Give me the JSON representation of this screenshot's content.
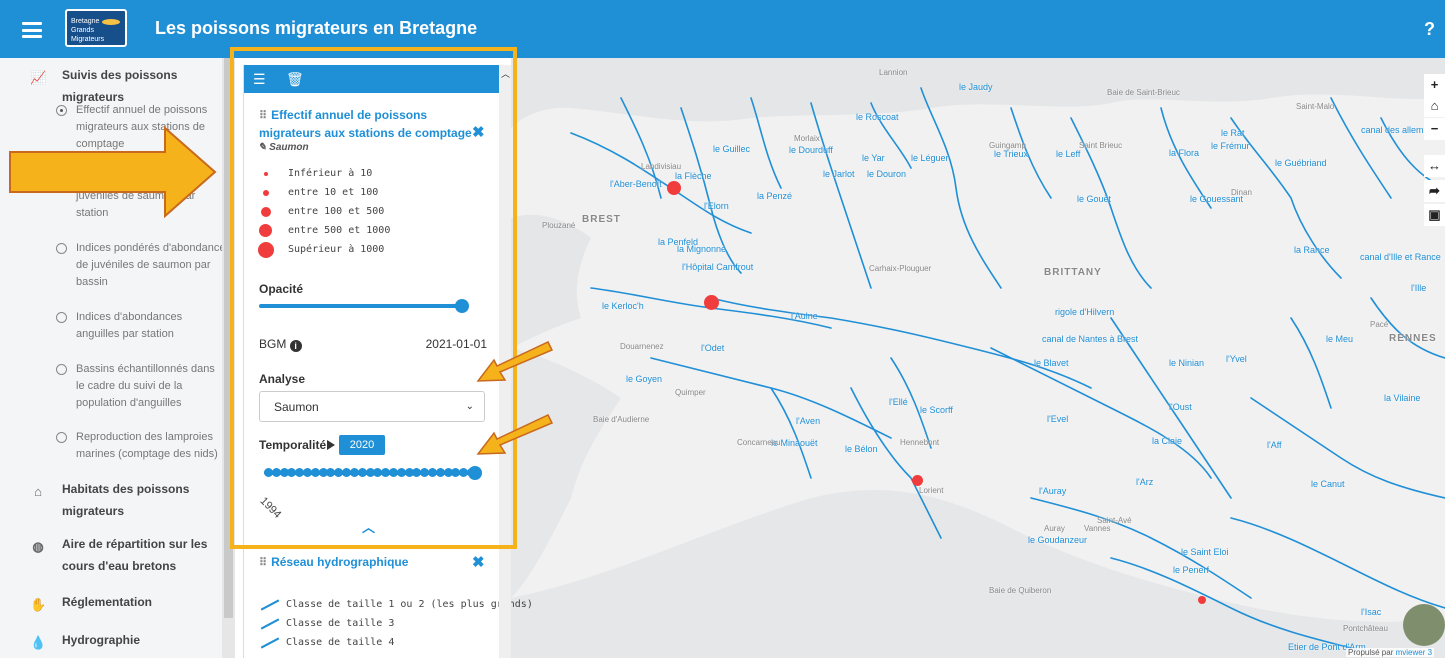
{
  "header": {
    "title": "Les poissons migrateurs en Bretagne",
    "logo_text_1": "Bretagne",
    "logo_text_2": "Grands Migrateurs",
    "help": "?",
    "bg_color": "#1f8fd6"
  },
  "sidebar": {
    "categories": [
      {
        "label": "Suivis des poissons migrateurs",
        "icon": "chart-line-icon"
      },
      {
        "label": "Habitats des poissons migrateurs",
        "icon": "house-icon"
      },
      {
        "label": "Aire de répartition sur les cours d'eau bretons",
        "icon": "globe-icon"
      },
      {
        "label": "Réglementation",
        "icon": "hand-icon"
      },
      {
        "label": "Hydrographie",
        "icon": "drop-icon"
      }
    ],
    "items": [
      {
        "label": "Effectif annuel de poissons migrateurs aux stations de comptage",
        "selected": true
      },
      {
        "label": "Indices d'abondance de juvéniles de saumon par station",
        "selected": false
      },
      {
        "label": "Indices pondérés d'abondance de juvéniles de saumon par bassin",
        "selected": false
      },
      {
        "label": "Indices d'abondances anguilles par station",
        "selected": false
      },
      {
        "label": "Bassins échantillonnés dans le cadre du suivi de la population d'anguilles",
        "selected": false
      },
      {
        "label": "Reproduction des lamproies marines (comptage des nids)",
        "selected": false
      }
    ]
  },
  "panel": {
    "layer_title": "Effectif annuel de poissons migrateurs aux stations de comptage",
    "sublabel": "Saumon",
    "legend": [
      "Inférieur à 10",
      "entre 10 et 100",
      "entre 100 et 500",
      "entre 500 et 1000",
      "Supérieur à 1000"
    ],
    "opacity_label": "Opacité",
    "opacity_value": 1.0,
    "source_label": "BGM",
    "source_date": "2021-01-01",
    "analyse_label": "Analyse",
    "analyse_value": "Saumon",
    "temporalite_label": "Temporalité",
    "temporalite_year": "2020",
    "year_start": "1994",
    "layer2_title": "Réseau hydrographique",
    "layer2_legend": [
      "Classe de taille 1 ou 2 (les plus grands)",
      "Classe de taille 3",
      "Classe de taille 4"
    ]
  },
  "map": {
    "labels": [
      {
        "text": "le Jaudy"
      },
      {
        "text": "le Roscoat"
      },
      {
        "text": "le Guillec"
      },
      {
        "text": "le Dourduff"
      },
      {
        "text": "le Yar"
      },
      {
        "text": "le Léguer"
      },
      {
        "text": "le Trieux"
      },
      {
        "text": "le Leff"
      },
      {
        "text": "le Jarlot"
      },
      {
        "text": "le Douron"
      },
      {
        "text": "la Flèche"
      },
      {
        "text": "l'Aber-Benoît"
      },
      {
        "text": "la Penzé"
      },
      {
        "text": "l'Elorn"
      },
      {
        "text": "la Penfeld"
      },
      {
        "text": "la Mignonne"
      },
      {
        "text": "l'Hôpital Camfrout"
      },
      {
        "text": "le Kerloc'h"
      },
      {
        "text": "le Gouët"
      },
      {
        "text": "le Gouessant"
      },
      {
        "text": "la Flora"
      },
      {
        "text": "le Frémur"
      },
      {
        "text": "le Rat"
      },
      {
        "text": "le Guébriand"
      },
      {
        "text": "la Rance"
      },
      {
        "text": "canal d'Ille et Rance"
      },
      {
        "text": "canal des allemands"
      },
      {
        "text": "l'Ille"
      },
      {
        "text": "le Meu"
      },
      {
        "text": "la Vilaine"
      },
      {
        "text": "l'Aulne"
      },
      {
        "text": "rigole d'Hilvern"
      },
      {
        "text": "canal de Nantes à Brest"
      },
      {
        "text": "le Blavet"
      },
      {
        "text": "le Ninian"
      },
      {
        "text": "l'Yvel"
      },
      {
        "text": "le Goyen"
      },
      {
        "text": "l'Odet"
      },
      {
        "text": "l'Ellé"
      },
      {
        "text": "le Scorff"
      },
      {
        "text": "l'Oust"
      },
      {
        "text": "l'Evel"
      },
      {
        "text": "l'Aven"
      },
      {
        "text": "le Minaouët"
      },
      {
        "text": "le Bélon"
      },
      {
        "text": "la Claie"
      },
      {
        "text": "l'Auray"
      },
      {
        "text": "l'Arz"
      },
      {
        "text": "le Canut"
      },
      {
        "text": "l'Aff"
      },
      {
        "text": "le Goudanzeur"
      },
      {
        "text": "le Saint Eloi"
      },
      {
        "text": "le Penerf"
      },
      {
        "text": "Etier de Pont d'Arm"
      },
      {
        "text": "l'Isac"
      },
      {
        "text": "BRITTANY"
      },
      {
        "text": "RENNES"
      },
      {
        "text": "BREST"
      },
      {
        "text": "Lorient"
      },
      {
        "text": "Saint-Malo"
      },
      {
        "text": "Saint Brieuc"
      },
      {
        "text": "Guingamp"
      },
      {
        "text": "Morlaix"
      },
      {
        "text": "Landivisiau"
      },
      {
        "text": "Plouzané"
      },
      {
        "text": "Carhaix-Plouguer"
      },
      {
        "text": "Douarnenez"
      },
      {
        "text": "Quimper"
      },
      {
        "text": "Concarneau"
      },
      {
        "text": "Hennebont"
      },
      {
        "text": "Vannes"
      },
      {
        "text": "Saint-Avé"
      },
      {
        "text": "Auray"
      },
      {
        "text": "Dinan"
      },
      {
        "text": "Pacé"
      },
      {
        "text": "Baie de Saint-Brieuc"
      },
      {
        "text": "Baie de Quiberon"
      },
      {
        "text": "Baie d'Audierne"
      },
      {
        "text": "Pontchâteau"
      },
      {
        "text": "Lannion"
      }
    ],
    "controls": [
      "+",
      "⌂",
      "−",
      "↔",
      "➦",
      "▣"
    ],
    "attribution_prefix": "Propulsé par",
    "attribution_link": "mviewer 3"
  }
}
